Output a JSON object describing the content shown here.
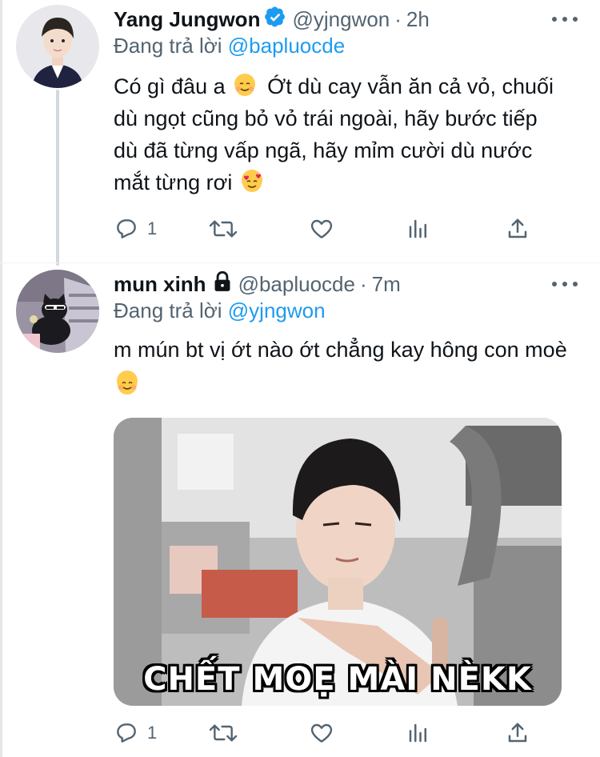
{
  "tweets": [
    {
      "name": "Yang Jungwon",
      "handle": "@yjngwon",
      "separator": "·",
      "time": "2h",
      "reply_prefix": "Đang trả lời ",
      "reply_mention": "@bapluocde",
      "text_parts": [
        "Có gì đâu a",
        "Ớt dù cay vẫn ăn cả vỏ, chuối dù ngọt cũng bỏ vỏ trái ngoài, hãy bước tiếp dù đã từng vấp ngã, hãy mỉm cười dù nước mắt từng rơi"
      ],
      "actions": {
        "reply_count": "1",
        "retweet_count": "",
        "like_count": ""
      },
      "verified": true
    },
    {
      "name": "mun xinh",
      "handle": "@bapluocde",
      "separator": "·",
      "time": "7m",
      "reply_prefix": "Đang trả lời ",
      "reply_mention": "@yjngwon",
      "text": "m mún bt vị ớt nào ớt chẳng kay hông con moè",
      "media_caption": "CHẾT MOẸ MÀI NÈKK",
      "actions": {
        "reply_count": "1",
        "retweet_count": "",
        "like_count": ""
      },
      "protected": true
    }
  ],
  "icons": {
    "reply": "reply-icon",
    "retweet": "retweet-icon",
    "like": "heart-icon",
    "analytics": "analytics-icon",
    "share": "share-icon",
    "more": "more-icon",
    "verified": "verified-badge-icon",
    "lock": "lock-icon"
  },
  "colors": {
    "link": "#1d9bf0",
    "secondary": "#536471",
    "text": "#0f1419",
    "verified": "#1d9bf0"
  }
}
